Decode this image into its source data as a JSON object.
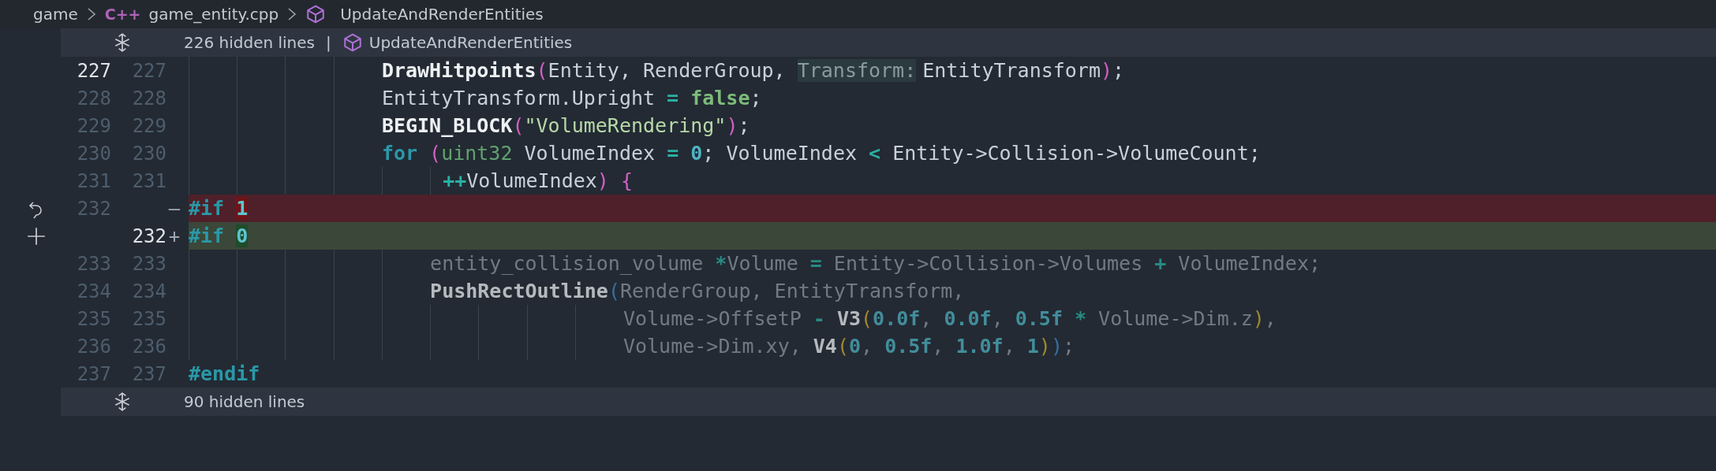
{
  "breadcrumb": {
    "items": [
      {
        "label": "game",
        "kind": "folder"
      },
      {
        "label": "game_entity.cpp",
        "kind": "file",
        "badge": "C++"
      },
      {
        "label": "UpdateAndRenderEntities",
        "kind": "symbol"
      }
    ]
  },
  "fold_top": {
    "text": "226 hidden lines",
    "separator": "|",
    "symbol": "UpdateAndRenderEntities"
  },
  "lines": [
    {
      "old": "227",
      "new": "227",
      "kind": "normal",
      "current": true,
      "inactive": false,
      "tokens": [
        {
          "text": "                DrawHitpoints",
          "kind": "fn"
        },
        {
          "text": "(",
          "kind": "p1"
        },
        {
          "text": "Entity, RenderGroup, ",
          "kind": "plain"
        },
        {
          "text": "Transform:",
          "kind": "hint"
        },
        {
          "text": "EntityTransform",
          "kind": "plain"
        },
        {
          "text": ")",
          "kind": "p1"
        },
        {
          "text": ";",
          "kind": "plain"
        }
      ]
    },
    {
      "old": "228",
      "new": "228",
      "kind": "normal",
      "current": false,
      "inactive": false,
      "tokens": [
        {
          "text": "                EntityTransform.Upright ",
          "kind": "plain"
        },
        {
          "text": "= ",
          "kind": "op"
        },
        {
          "text": "false",
          "kind": "lit"
        },
        {
          "text": ";",
          "kind": "plain"
        }
      ]
    },
    {
      "old": "229",
      "new": "229",
      "kind": "normal",
      "current": false,
      "inactive": false,
      "tokens": [
        {
          "text": "                BEGIN_BLOCK",
          "kind": "fn"
        },
        {
          "text": "(",
          "kind": "p1"
        },
        {
          "text": "\"VolumeRendering\"",
          "kind": "str"
        },
        {
          "text": ")",
          "kind": "p1"
        },
        {
          "text": ";",
          "kind": "plain"
        }
      ]
    },
    {
      "old": "230",
      "new": "230",
      "kind": "normal",
      "current": false,
      "inactive": false,
      "tokens": [
        {
          "text": "                for ",
          "kind": "kw"
        },
        {
          "text": "(",
          "kind": "p1"
        },
        {
          "text": "uint32",
          "kind": "type"
        },
        {
          "text": " VolumeIndex ",
          "kind": "plain"
        },
        {
          "text": "= ",
          "kind": "op"
        },
        {
          "text": "0",
          "kind": "num"
        },
        {
          "text": "; VolumeIndex ",
          "kind": "plain"
        },
        {
          "text": "<",
          "kind": "op"
        },
        {
          "text": " Entity->Collision->VolumeCount;",
          "kind": "plain"
        }
      ]
    },
    {
      "old": "231",
      "new": "231",
      "kind": "normal",
      "current": false,
      "inactive": false,
      "tokens": [
        {
          "text": "                     ++",
          "kind": "op"
        },
        {
          "text": "VolumeIndex",
          "kind": "plain"
        },
        {
          "text": ") {",
          "kind": "p1"
        }
      ]
    },
    {
      "old": "232",
      "marker": "—",
      "kind": "deleted",
      "current": false,
      "inactive": false,
      "tokens": [
        {
          "text": "#if ",
          "kind": "pre"
        },
        {
          "text": "1",
          "kind": "changed"
        }
      ]
    },
    {
      "new": "232",
      "marker": "+",
      "kind": "added",
      "inactive": false,
      "tokens": [
        {
          "text": "#if ",
          "kind": "pre"
        },
        {
          "text": "0",
          "kind": "changed"
        }
      ]
    },
    {
      "old": "233",
      "new": "233",
      "kind": "normal",
      "current": false,
      "inactive": true,
      "tokens": [
        {
          "text": "                    entity_collision_volume ",
          "kind": "plain"
        },
        {
          "text": "*",
          "kind": "op"
        },
        {
          "text": "Volume ",
          "kind": "plain"
        },
        {
          "text": "=",
          "kind": "op"
        },
        {
          "text": " Entity->Collision->Volumes ",
          "kind": "plain"
        },
        {
          "text": "+",
          "kind": "op"
        },
        {
          "text": " VolumeIndex;",
          "kind": "plain"
        }
      ]
    },
    {
      "old": "234",
      "new": "234",
      "kind": "normal",
      "current": false,
      "inactive": true,
      "tokens": [
        {
          "text": "                    PushRectOutline",
          "kind": "fn"
        },
        {
          "text": "(",
          "kind": "p3"
        },
        {
          "text": "RenderGroup, EntityTransform,",
          "kind": "plain"
        }
      ]
    },
    {
      "old": "235",
      "new": "235",
      "kind": "normal",
      "current": false,
      "inactive": true,
      "tokens": [
        {
          "text": "                                    Volume->OffsetP ",
          "kind": "plain"
        },
        {
          "text": "- ",
          "kind": "op"
        },
        {
          "text": "V3",
          "kind": "fn"
        },
        {
          "text": "(",
          "kind": "p2"
        },
        {
          "text": "0.0f",
          "kind": "num"
        },
        {
          "text": ", ",
          "kind": "plain"
        },
        {
          "text": "0.0f",
          "kind": "num"
        },
        {
          "text": ", ",
          "kind": "plain"
        },
        {
          "text": "0.5f",
          "kind": "num"
        },
        {
          "text": " *",
          "kind": "op"
        },
        {
          "text": " Volume->Dim.z",
          "kind": "plain"
        },
        {
          "text": ")",
          "kind": "p2"
        },
        {
          "text": ",",
          "kind": "plain"
        }
      ]
    },
    {
      "old": "236",
      "new": "236",
      "kind": "normal",
      "current": false,
      "inactive": true,
      "tokens": [
        {
          "text": "                                    Volume->Dim.xy, ",
          "kind": "plain"
        },
        {
          "text": "V4",
          "kind": "fn"
        },
        {
          "text": "(",
          "kind": "p2"
        },
        {
          "text": "0",
          "kind": "num"
        },
        {
          "text": ", ",
          "kind": "plain"
        },
        {
          "text": "0.5f",
          "kind": "num"
        },
        {
          "text": ", ",
          "kind": "plain"
        },
        {
          "text": "1.0f",
          "kind": "num"
        },
        {
          "text": ", ",
          "kind": "plain"
        },
        {
          "text": "1",
          "kind": "num"
        },
        {
          "text": ")",
          "kind": "p2"
        },
        {
          "text": ")",
          "kind": "p3"
        },
        {
          "text": ";",
          "kind": "plain"
        }
      ]
    },
    {
      "old": "237",
      "new": "237",
      "kind": "normal",
      "current": false,
      "inactive": false,
      "tokens": [
        {
          "text": "#endif",
          "kind": "pre"
        }
      ]
    }
  ],
  "fold_bottom": {
    "text": "90 hidden lines"
  }
}
